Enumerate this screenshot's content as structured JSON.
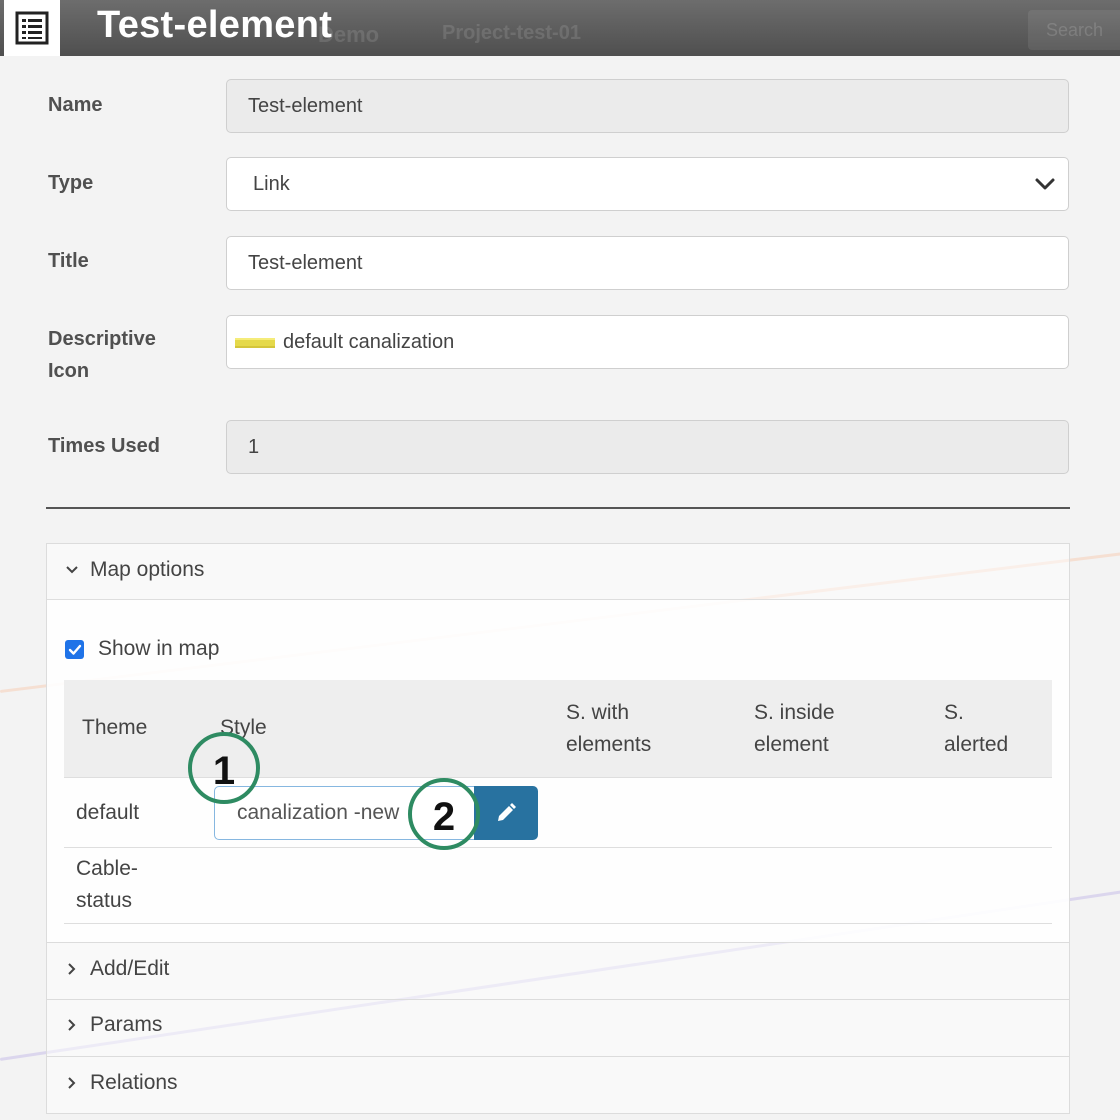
{
  "header": {
    "title": "Test-element",
    "ghost_tab_1": "Demo",
    "ghost_tab_2": "Project-test-01",
    "ghost_search": "Search",
    "icon": "list-icon"
  },
  "form": {
    "name": {
      "label": "Name",
      "value": "Test-element"
    },
    "type": {
      "label": "Type",
      "value": "Link"
    },
    "title": {
      "label": "Title",
      "value": "Test-element"
    },
    "descriptive_icon": {
      "label_line1": "Descriptive",
      "label_line2": "Icon",
      "value": "default canalization",
      "swatch_color": "#e5d94a"
    },
    "times_used": {
      "label": "Times Used",
      "value": "1"
    }
  },
  "map_options": {
    "header": "Map options",
    "show_in_map_label": "Show in map",
    "show_in_map_checked": true,
    "columns": {
      "theme": "Theme",
      "style": "Style",
      "with_elements_1": "S. with",
      "with_elements_2": "elements",
      "inside_element_1": "S. inside",
      "inside_element_2": "element",
      "alerted_1": "S.",
      "alerted_2": "alerted"
    },
    "rows": [
      {
        "theme": "default",
        "style": "canalization -new"
      },
      {
        "theme_line1": "Cable-",
        "theme_line2": "status"
      }
    ]
  },
  "sections": {
    "add_edit": "Add/Edit",
    "params": "Params",
    "relations": "Relations"
  },
  "callouts": {
    "one": "1",
    "two": "2",
    "color": "#2e8b62"
  },
  "colors": {
    "accent_button": "#2872a0",
    "checkbox": "#1f73e8"
  }
}
